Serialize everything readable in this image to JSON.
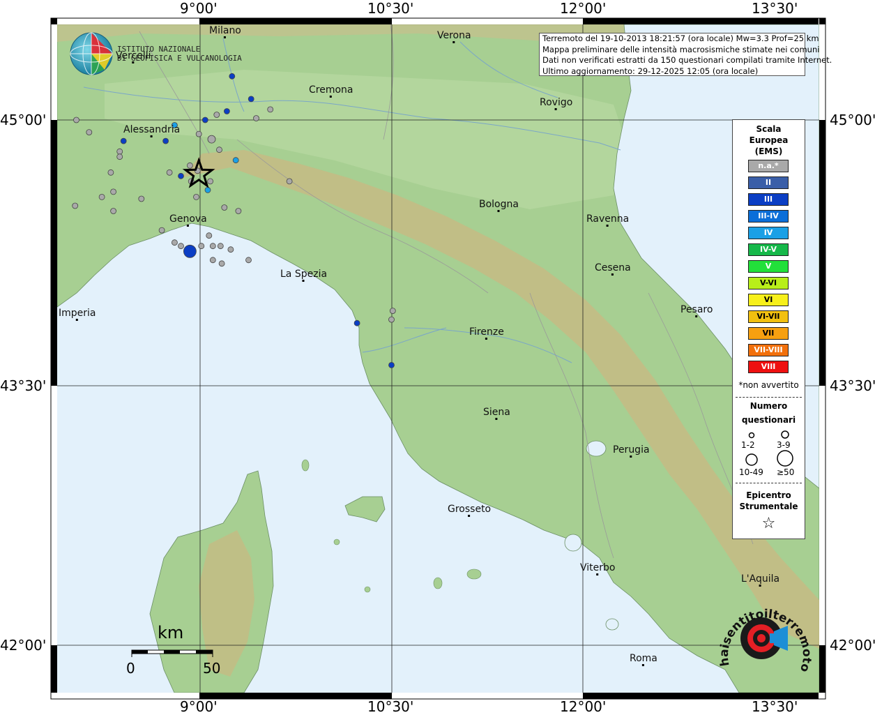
{
  "map": {
    "coords": {
      "top": [
        "9°00'",
        "10°30'",
        "12°00'",
        "13°30'"
      ],
      "bottom": [
        "9°00'",
        "10°30'",
        "12°00'",
        "13°30'"
      ],
      "left": [
        "45°00'",
        "43°30'",
        "42°00'"
      ],
      "right": [
        "45°00'",
        "43°30'",
        "42°00'"
      ]
    },
    "cities": [
      {
        "name": "Milano"
      },
      {
        "name": "Verona"
      },
      {
        "name": "Vercelli"
      },
      {
        "name": "Cremona"
      },
      {
        "name": "Rovigo"
      },
      {
        "name": "Alessandria"
      },
      {
        "name": "Bologna"
      },
      {
        "name": "Ravenna"
      },
      {
        "name": "Genova"
      },
      {
        "name": "Cesena"
      },
      {
        "name": "La Spezia"
      },
      {
        "name": "Pesaro"
      },
      {
        "name": "Imperia"
      },
      {
        "name": "Firenze"
      },
      {
        "name": "Siena"
      },
      {
        "name": "Perugia"
      },
      {
        "name": "Grosseto"
      },
      {
        "name": "Viterbo"
      },
      {
        "name": "L'Aquila"
      },
      {
        "name": "Roma"
      }
    ]
  },
  "info": {
    "line1": "Terremoto del 19-10-2013 18:21:57 (ora locale) Mw=3.3 Prof=25 km",
    "line2": "Mappa preliminare delle intensità macrosismiche stimate nei comuni",
    "line3": "Dati non verificati estratti da 150 questionari compilati tramite Internet.",
    "line4": "Ultimo aggiornamento: 29-12-2025 12:05 (ora locale)"
  },
  "logo": {
    "line1": "ISTITUTO NAZIONALE",
    "line2": "DI GEOFISICA E VULCANOLOGIA",
    "stamp_text": "haisentitoilterremoto.it"
  },
  "legend": {
    "title1": "Scala",
    "title2": "Europea",
    "title3": "(EMS)",
    "items": [
      {
        "label": "n.a.*",
        "color": "#a9a9a9"
      },
      {
        "label": "II",
        "color": "#3a5ea8"
      },
      {
        "label": "III",
        "color": "#0b3ec4"
      },
      {
        "label": "III-IV",
        "color": "#0b6ed8"
      },
      {
        "label": "IV",
        "color": "#1aa0e6"
      },
      {
        "label": "IV-V",
        "color": "#16b84a"
      },
      {
        "label": "V",
        "color": "#22e03a"
      },
      {
        "label": "V-VI",
        "color": "#b8ef1a"
      },
      {
        "label": "VI",
        "color": "#f7f01a"
      },
      {
        "label": "VI-VII",
        "color": "#f2c010"
      },
      {
        "label": "VII",
        "color": "#f7a010"
      },
      {
        "label": "VII-VIII",
        "color": "#f2700c"
      },
      {
        "label": "VIII",
        "color": "#ee1010"
      }
    ],
    "note": "*non avvertito",
    "count_title1": "Numero",
    "count_title2": "questionari",
    "counts": [
      "1-2",
      "3-9",
      "10-49",
      "≥50"
    ],
    "epi_title1": "Epicentro",
    "epi_title2": "Strumentale",
    "epi_symbol": "☆"
  },
  "scale": {
    "unit": "km",
    "start": "0",
    "end": "50"
  },
  "observations": [
    {
      "lon": 8.43,
      "lat": 45.68,
      "int": "III",
      "n": 1
    },
    {
      "lon": 8.8,
      "lat": 44.97,
      "int": "IV",
      "n": 1
    },
    {
      "lon": 8.73,
      "lat": 44.88,
      "int": "III",
      "n": 1
    },
    {
      "lon": 8.4,
      "lat": 44.88,
      "int": "III",
      "n": 2
    },
    {
      "lon": 8.03,
      "lat": 45.0,
      "int": "n.a.",
      "n": 1
    },
    {
      "lon": 8.13,
      "lat": 44.93,
      "int": "n.a.",
      "n": 1
    },
    {
      "lon": 8.37,
      "lat": 44.82,
      "int": "n.a.",
      "n": 1
    },
    {
      "lon": 9.04,
      "lat": 45.0,
      "int": "III",
      "n": 2
    },
    {
      "lon": 9.13,
      "lat": 45.03,
      "int": "n.a.",
      "n": 1
    },
    {
      "lon": 9.09,
      "lat": 44.89,
      "int": "n.a.",
      "n": 3
    },
    {
      "lon": 8.99,
      "lat": 44.92,
      "int": "n.a.",
      "n": 1
    },
    {
      "lon": 9.25,
      "lat": 45.25,
      "int": "III",
      "n": 1
    },
    {
      "lon": 9.21,
      "lat": 45.05,
      "int": "III",
      "n": 1
    },
    {
      "lon": 9.4,
      "lat": 45.12,
      "int": "III",
      "n": 1
    },
    {
      "lon": 9.55,
      "lat": 45.06,
      "int": "n.a.",
      "n": 1
    },
    {
      "lon": 9.44,
      "lat": 45.01,
      "int": "n.a.",
      "n": 1
    },
    {
      "lon": 9.15,
      "lat": 44.83,
      "int": "n.a.",
      "n": 1
    },
    {
      "lon": 9.28,
      "lat": 44.77,
      "int": "IV",
      "n": 1
    },
    {
      "lon": 8.92,
      "lat": 44.74,
      "int": "n.a.",
      "n": 2
    },
    {
      "lon": 8.98,
      "lat": 44.71,
      "int": "n.a.",
      "n": 1
    },
    {
      "lon": 8.85,
      "lat": 44.68,
      "int": "III",
      "n": 2
    },
    {
      "lon": 8.93,
      "lat": 44.65,
      "int": "n.a.",
      "n": 2
    },
    {
      "lon": 8.76,
      "lat": 44.7,
      "int": "n.a.",
      "n": 1
    },
    {
      "lon": 8.3,
      "lat": 44.7,
      "int": "n.a.",
      "n": 1
    },
    {
      "lon": 8.37,
      "lat": 44.79,
      "int": "n.a.",
      "n": 1
    },
    {
      "lon": 8.32,
      "lat": 44.59,
      "int": "n.a.",
      "n": 1
    },
    {
      "lon": 8.23,
      "lat": 44.56,
      "int": "n.a.",
      "n": 1
    },
    {
      "lon": 8.54,
      "lat": 44.55,
      "int": "n.a.",
      "n": 1
    },
    {
      "lon": 8.02,
      "lat": 44.51,
      "int": "n.a.",
      "n": 1
    },
    {
      "lon": 8.32,
      "lat": 44.48,
      "int": "n.a.",
      "n": 1
    },
    {
      "lon": 9.08,
      "lat": 44.65,
      "int": "n.a.",
      "n": 1
    },
    {
      "lon": 9.06,
      "lat": 44.6,
      "int": "IV",
      "n": 1
    },
    {
      "lon": 8.97,
      "lat": 44.56,
      "int": "n.a.",
      "n": 1
    },
    {
      "lon": 9.19,
      "lat": 44.5,
      "int": "n.a.",
      "n": 1
    },
    {
      "lon": 9.3,
      "lat": 44.48,
      "int": "n.a.",
      "n": 1
    },
    {
      "lon": 9.7,
      "lat": 44.65,
      "int": "n.a.",
      "n": 1
    },
    {
      "lon": 8.7,
      "lat": 44.37,
      "int": "n.a.",
      "n": 1
    },
    {
      "lon": 8.8,
      "lat": 44.3,
      "int": "n.a.",
      "n": 1
    },
    {
      "lon": 9.07,
      "lat": 44.34,
      "int": "n.a.",
      "n": 1
    },
    {
      "lon": 9.01,
      "lat": 44.28,
      "int": "n.a.",
      "n": 1
    },
    {
      "lon": 9.1,
      "lat": 44.28,
      "int": "n.a.",
      "n": 1
    },
    {
      "lon": 9.16,
      "lat": 44.28,
      "int": "n.a.",
      "n": 1
    },
    {
      "lon": 9.24,
      "lat": 44.26,
      "int": "n.a.",
      "n": 1
    },
    {
      "lon": 8.92,
      "lat": 44.25,
      "int": "III",
      "n": 50
    },
    {
      "lon": 8.85,
      "lat": 44.28,
      "int": "n.a.",
      "n": 1
    },
    {
      "lon": 9.1,
      "lat": 44.2,
      "int": "n.a.",
      "n": 1
    },
    {
      "lon": 9.17,
      "lat": 44.18,
      "int": "n.a.",
      "n": 1
    },
    {
      "lon": 9.38,
      "lat": 44.2,
      "int": "n.a.",
      "n": 1
    },
    {
      "lon": 10.23,
      "lat": 43.84,
      "int": "III",
      "n": 1
    },
    {
      "lon": 10.5,
      "lat": 43.86,
      "int": "n.a.",
      "n": 1
    },
    {
      "lon": 10.5,
      "lat": 43.6,
      "int": "III",
      "n": 1
    },
    {
      "lon": 10.51,
      "lat": 43.91,
      "int": "n.a.",
      "n": 1
    }
  ],
  "epicenter": {
    "lon": 8.99,
    "lat": 44.69
  }
}
